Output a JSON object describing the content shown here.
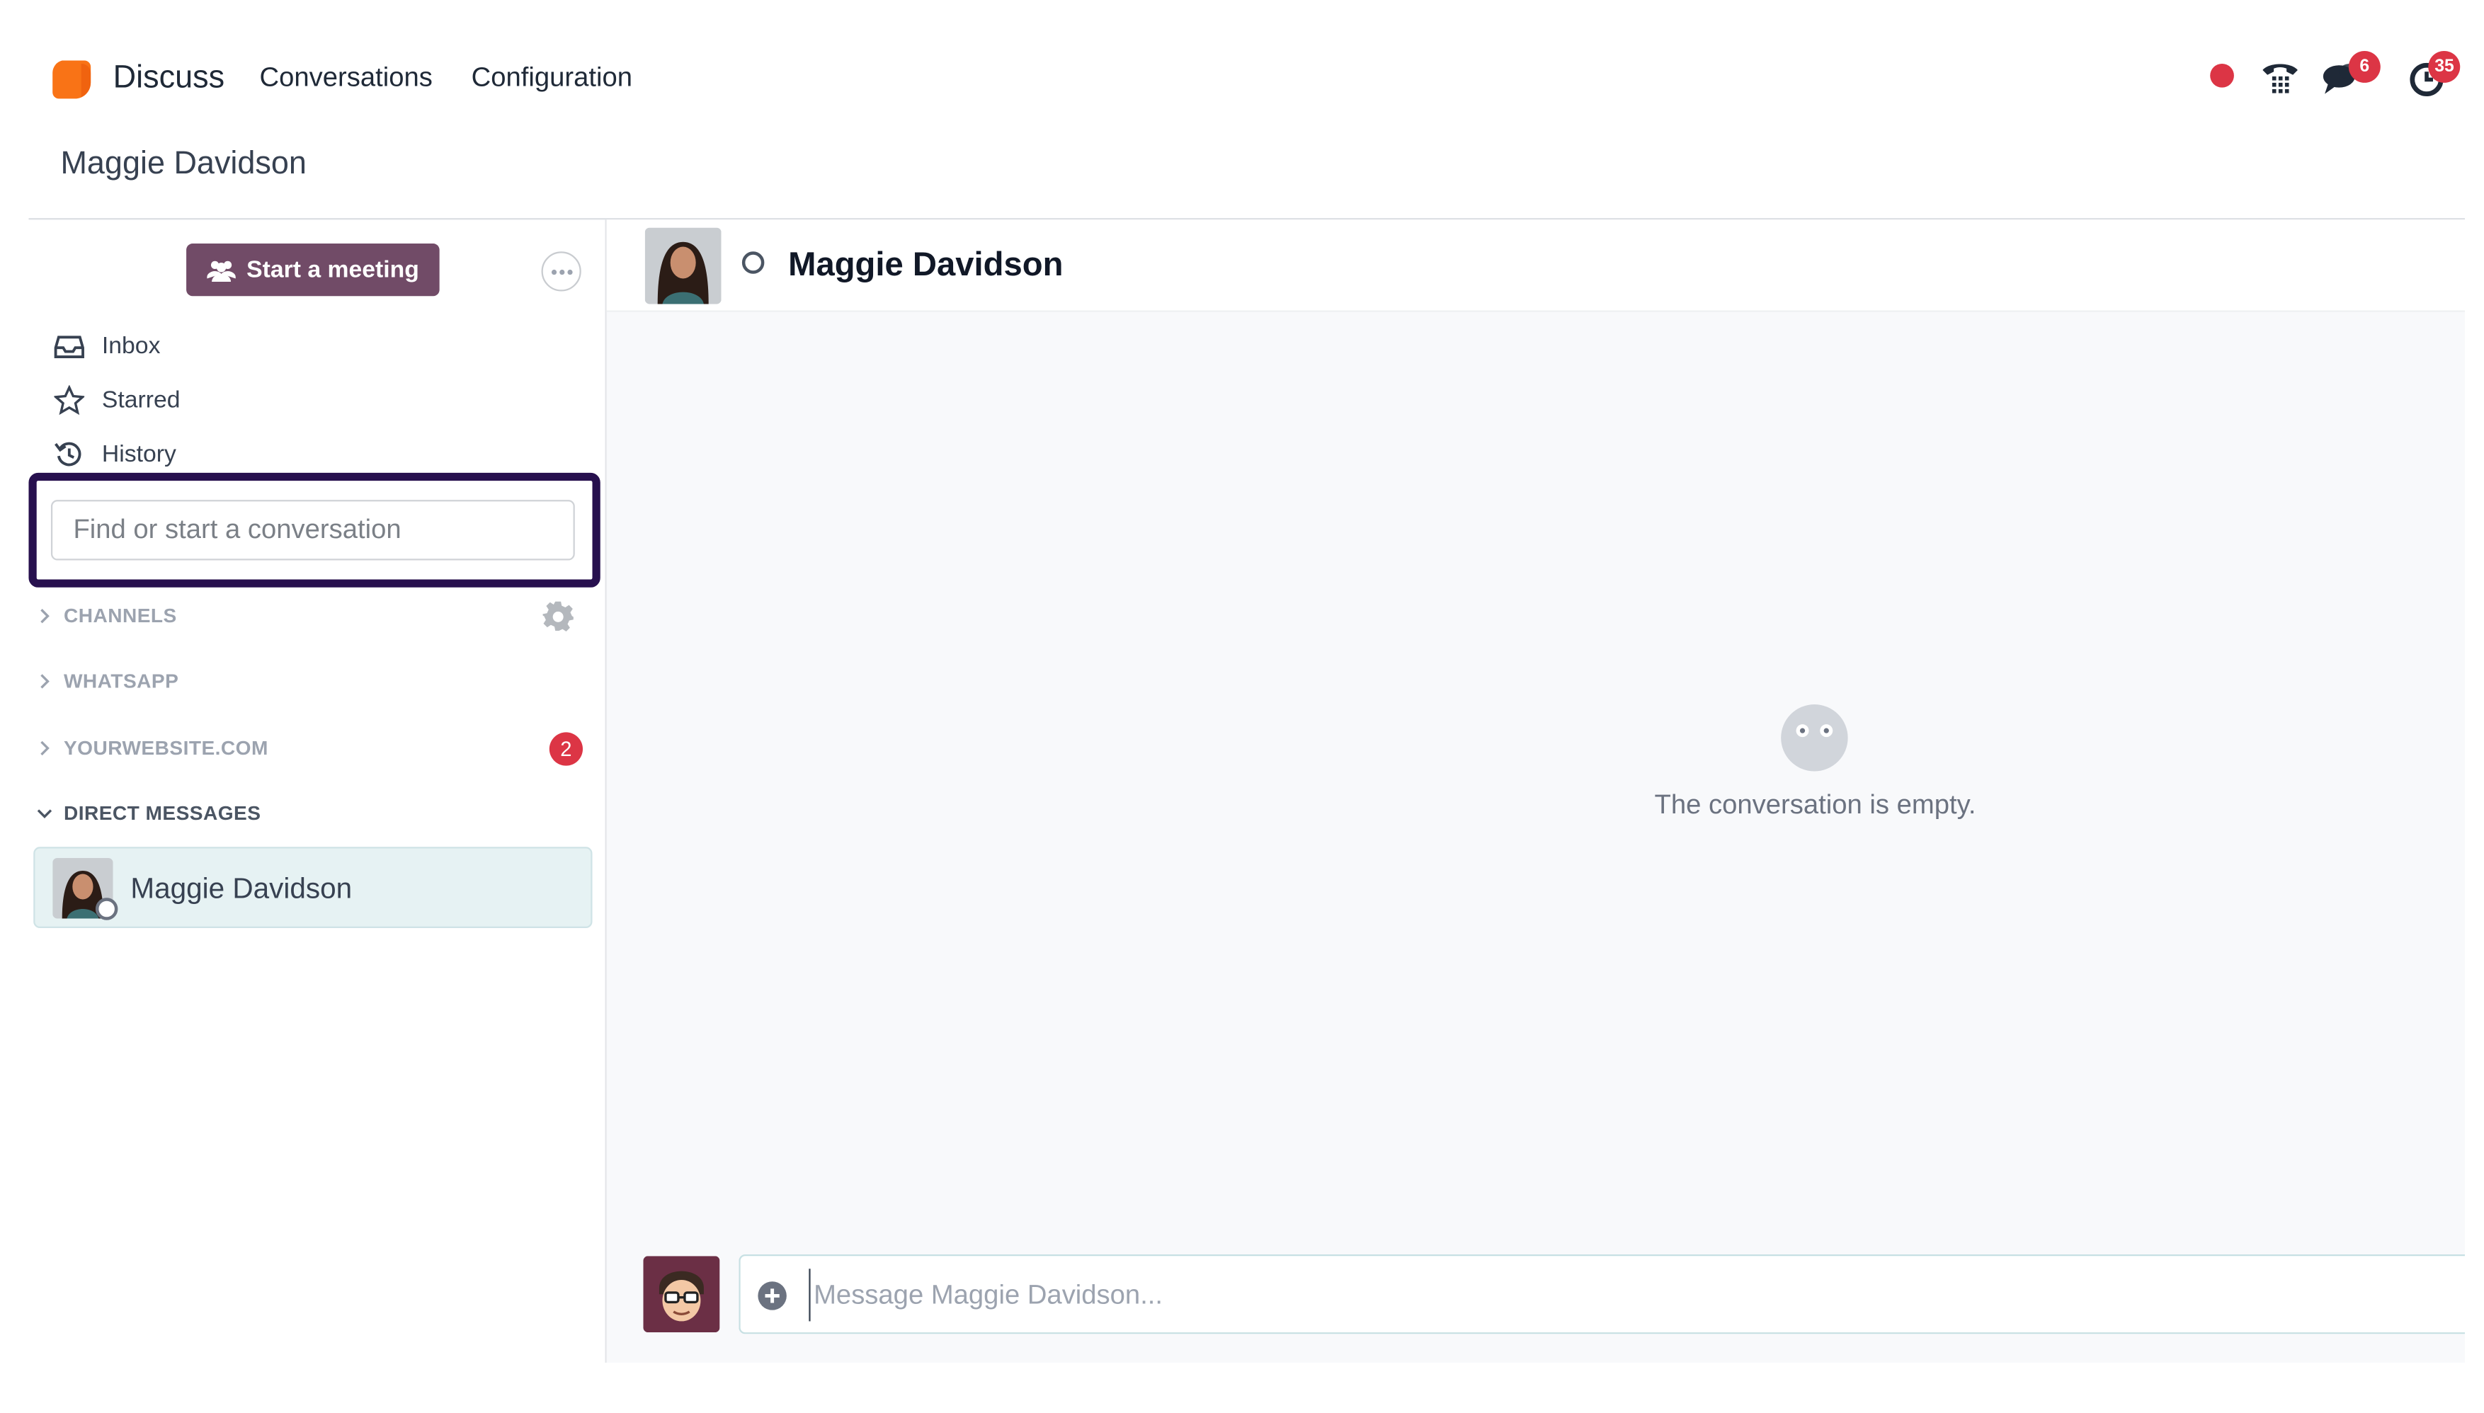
{
  "navbar": {
    "app_name": "Discuss",
    "menu": [
      "Conversations",
      "Configuration"
    ],
    "chat_badge": "6",
    "activity_badge": "35",
    "brand_color": "#f97316"
  },
  "breadcrumb": "Maggie Davidson",
  "sidebar": {
    "meeting_button": "Start a meeting",
    "nav_items": [
      {
        "label": "Inbox",
        "icon": "inbox-icon"
      },
      {
        "label": "Starred",
        "icon": "star-icon"
      },
      {
        "label": "History",
        "icon": "history-icon"
      }
    ],
    "search_placeholder": "Find or start a conversation",
    "categories": [
      {
        "label": "CHANNELS",
        "expanded": false
      },
      {
        "label": "WHATSAPP",
        "expanded": false
      },
      {
        "label": "YOURWEBSITE.COM",
        "expanded": false,
        "badge": "2"
      },
      {
        "label": "DIRECT MESSAGES",
        "expanded": true
      }
    ],
    "direct_messages": [
      {
        "name": "Maggie Davidson",
        "status": "offline"
      }
    ],
    "accent_color": "#714b67"
  },
  "thread": {
    "title": "Maggie Davidson",
    "empty_text": "The conversation is empty.",
    "composer_placeholder": "Message Maggie Davidson..."
  }
}
